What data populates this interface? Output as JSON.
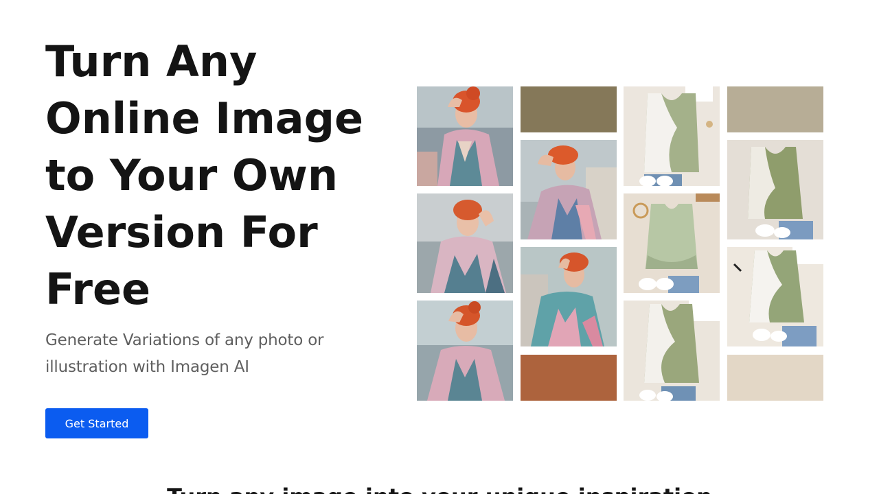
{
  "hero": {
    "title": "Turn Any Online Image to Your Own Version For Free",
    "subtitle": "Generate Variations of any photo or illustration with Imagen AI",
    "cta_label": "Get Started"
  },
  "next_section": {
    "heading": "Turn any image into your unique inspiration"
  },
  "colors": {
    "accent": "#0b5cf0",
    "title": "#141414",
    "subtitle": "#5f5f5f",
    "swatch_olive": "#857859",
    "swatch_rust": "#ad633d",
    "swatch_taupe": "#b7ad96",
    "swatch_cream": "#e3d7c6"
  }
}
